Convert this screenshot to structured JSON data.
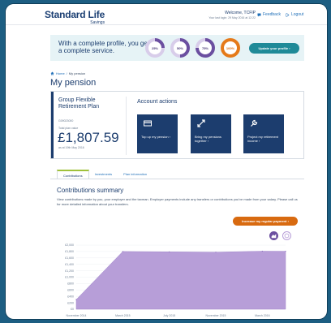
{
  "header": {
    "logo_main": "Standard Life",
    "logo_sub": "Savings",
    "welcome": "Welcome, TCFIP",
    "last_login": "Your last login: 29 May 2016 at 12:22",
    "feedback": "Feedback",
    "logout": "Logout"
  },
  "banner": {
    "text": "With a complete profile, you get a complete service.",
    "rings": [
      {
        "label": "25%",
        "progress": 25,
        "color": "#6b4fa0"
      },
      {
        "label": "50%",
        "progress": 50,
        "color": "#6b4fa0"
      },
      {
        "label": "75%",
        "progress": 75,
        "color": "#6b4fa0"
      },
      {
        "label": "100%",
        "progress": 100,
        "color": "#e57a1a"
      }
    ],
    "update_button": "Update your profile ›"
  },
  "breadcrumb": {
    "home": "Home",
    "current": "My pension"
  },
  "page_title": "My pension",
  "plan": {
    "name": "Group Flexible Retirement Plan",
    "number": "G09023000",
    "value_label": "Total plan value",
    "value": "£1,807.59",
    "as_of": "as at 19th May 2016"
  },
  "actions": {
    "title": "Account actions",
    "items": [
      {
        "label": "Top up my pension ›",
        "icon": "card-icon"
      },
      {
        "label": "Bring my pensions together ›",
        "icon": "merge-arrows-icon"
      },
      {
        "label": "Project my retirement income ›",
        "icon": "wrench-icon"
      }
    ]
  },
  "tabs": [
    "Contributions",
    "Investments",
    "Plan information"
  ],
  "contributions": {
    "title": "Contributions summary",
    "description": "View contributions made by you, your employer and the taxman. Employer payments include any transfers or contributions you've made from your salary. Please call us for more detailed information about your transfers.",
    "increase_button": "Increase my regular payment ›"
  },
  "colors": {
    "brand": "#1c3d6e",
    "accent_purple": "#b79ed8",
    "accent_orange": "#d86a10",
    "teal": "#1f8a98"
  },
  "chart_data": {
    "type": "area",
    "y_ticks": [
      "£2,000",
      "£1,800",
      "£1,600",
      "£1,400",
      "£1,200",
      "£1,000",
      "£800",
      "£600",
      "£400",
      "£200",
      "£0"
    ],
    "ylim": [
      0,
      2000
    ],
    "x_ticks": [
      "November 2014",
      "March 2015",
      "July 2015",
      "November 2015",
      "March 2016"
    ],
    "x": [
      "2014-11",
      "2015-03",
      "2015-07",
      "2015-11",
      "2016-03",
      "2016-05"
    ],
    "series": [
      {
        "values": [
          300,
          1800,
          1790,
          1780,
          1810,
          1807.59
        ]
      }
    ]
  }
}
